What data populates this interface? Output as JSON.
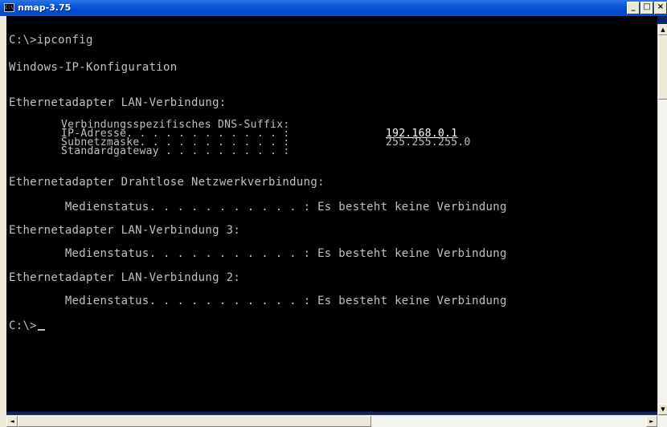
{
  "window": {
    "title": "nmap-3.75",
    "icon_label": "C:\\",
    "buttons": {
      "minimize": "_",
      "maximize": "□",
      "close": "×"
    }
  },
  "console": {
    "lines": [
      "C:\\>ipconfig",
      "Windows-IP-Konfiguration",
      "Ethernetadapter LAN-Verbindung:",
      "        Verbindungsspezifisches DNS-Suffix:",
      "        IP-Adresse. . . . . . . . . . . . :",
      "192.168.0.1",
      "        Subnetzmaske. . . . . . . . . . . :",
      "255.255.255.0",
      "        Standardgateway . . . . . . . . . :",
      "Ethernetadapter Drahtlose Netzwerkverbindung:",
      "        Medienstatus. . . . . . . . . . . : Es besteht keine Verbindung",
      "Ethernetadapter LAN-Verbindung 3:",
      "        Medienstatus. . . . . . . . . . . : Es besteht keine Verbindung",
      "Ethernetadapter LAN-Verbindung 2:",
      "        Medienstatus. . . . . . . . . . . : Es besteht keine Verbindung",
      "C:\\>"
    ]
  },
  "scrollbars": {
    "up_arrow": "▲",
    "down_arrow": "▼",
    "left_arrow": "◄",
    "right_arrow": "►"
  },
  "colors": {
    "titlebar": "#0a5ad8",
    "console_bg": "#000000",
    "console_text": "#c0c0c0"
  }
}
